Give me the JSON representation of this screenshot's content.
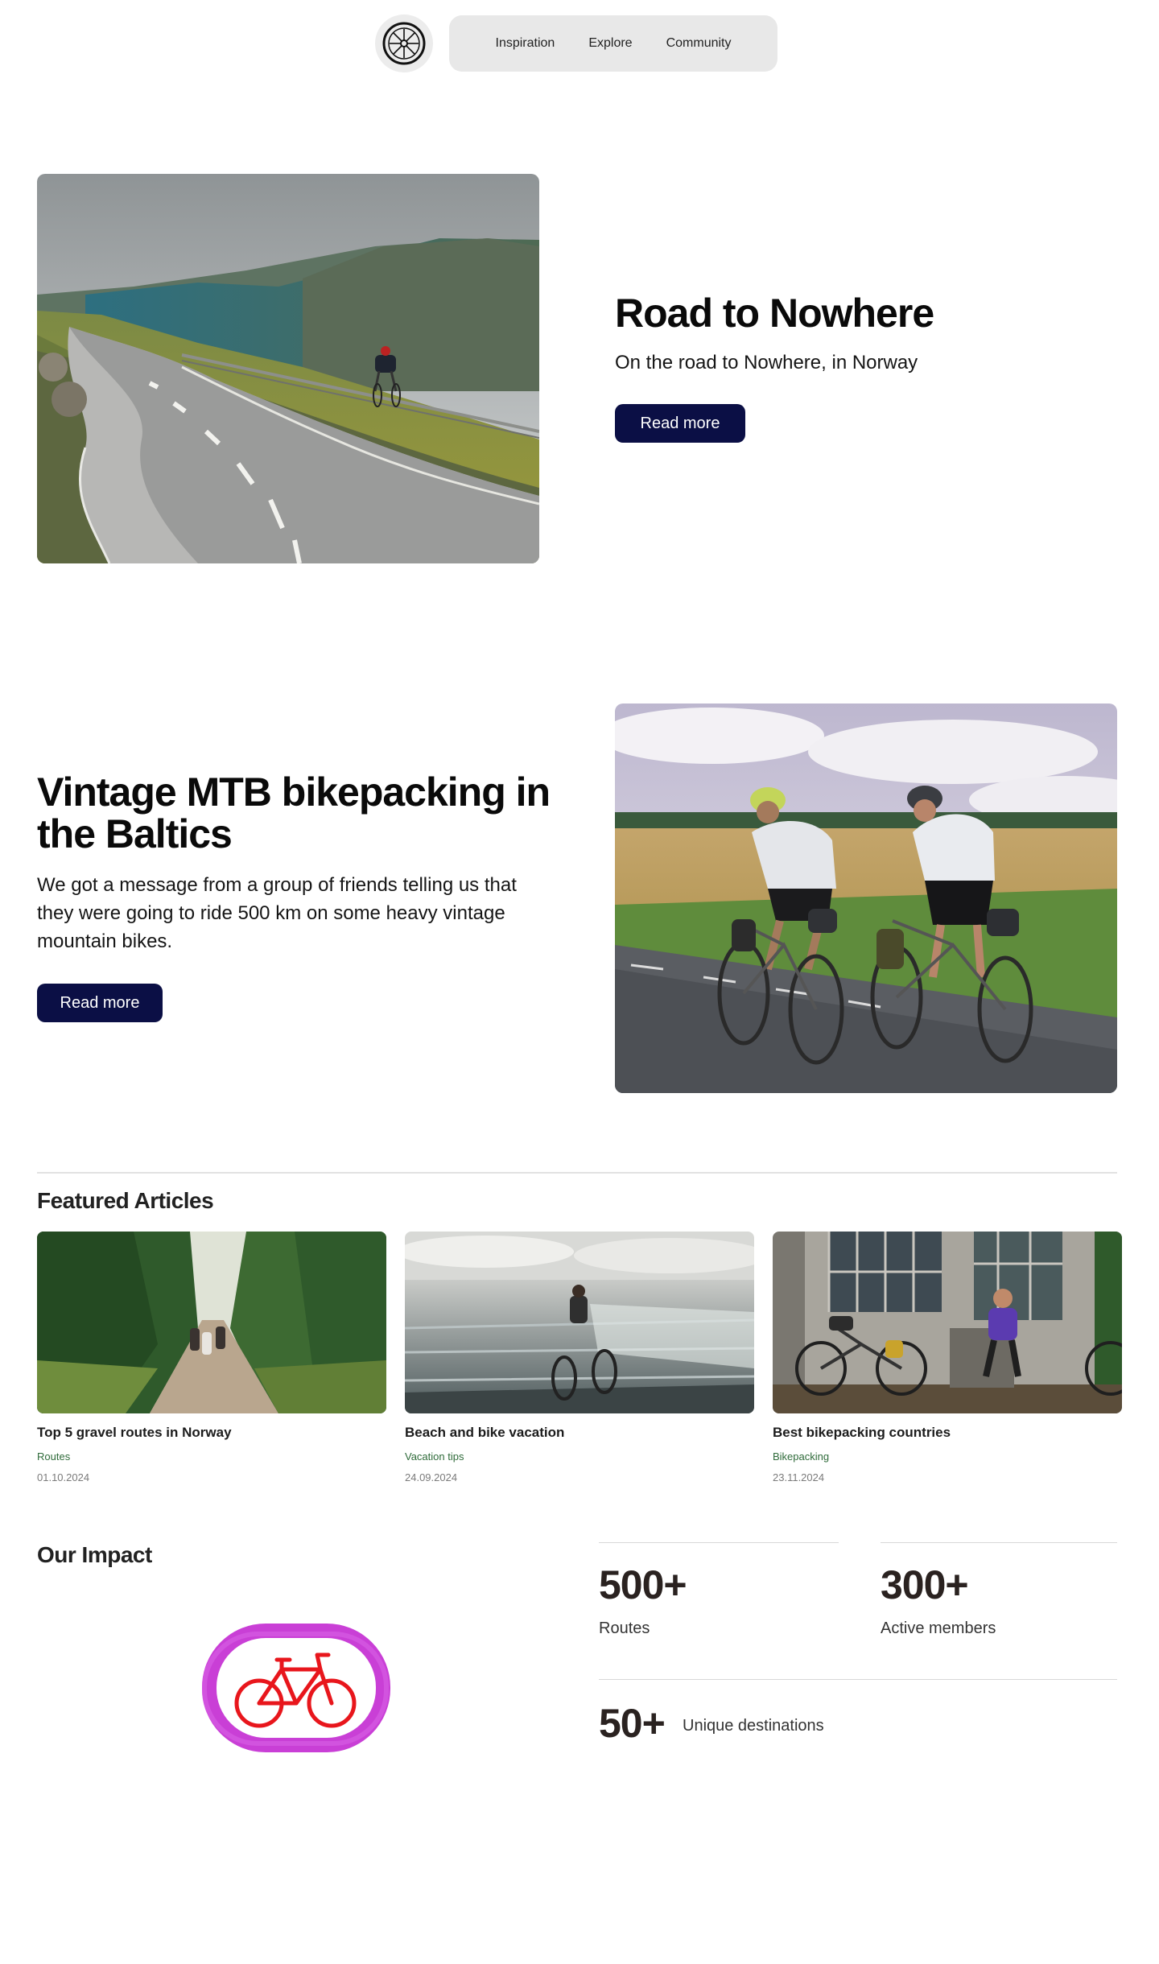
{
  "nav": {
    "links": [
      "Inspiration",
      "Explore",
      "Community"
    ]
  },
  "hero1": {
    "title": "Road to Nowhere",
    "subtitle": "On the road to Nowhere, in Norway",
    "button": "Read  more"
  },
  "hero2": {
    "title_line1": "Vintage MTB bikepacking in",
    "title_line2": "the Baltics",
    "text_line1": "We got a message from a group of friends telling us that",
    "text_line2": "they were going to ride 500 km on some heavy vintage",
    "text_line3": "mountain bikes.",
    "button": "Read more"
  },
  "featured": {
    "title": "Featured Articles",
    "articles": [
      {
        "title": "Top 5 gravel routes in Norway",
        "category": "Routes",
        "date": "01.10.2024"
      },
      {
        "title": "Beach and bike vacation",
        "category": "Vacation tips",
        "date": "24.09.2024"
      },
      {
        "title": "Best bikepacking countries",
        "category": "Bikepacking",
        "date": "23.11.2024"
      }
    ]
  },
  "impact": {
    "title": "Our Impact",
    "stats": [
      {
        "value": "500+",
        "label": "Routes"
      },
      {
        "value": "300+",
        "label": "Active members"
      },
      {
        "value": "50+",
        "label": "Unique destinations"
      }
    ]
  },
  "colors": {
    "button_bg": "#0b0f45",
    "category_green": "#2f6b3a",
    "badge_magenta": "#c93fd6",
    "bike_red": "#e8161c"
  }
}
